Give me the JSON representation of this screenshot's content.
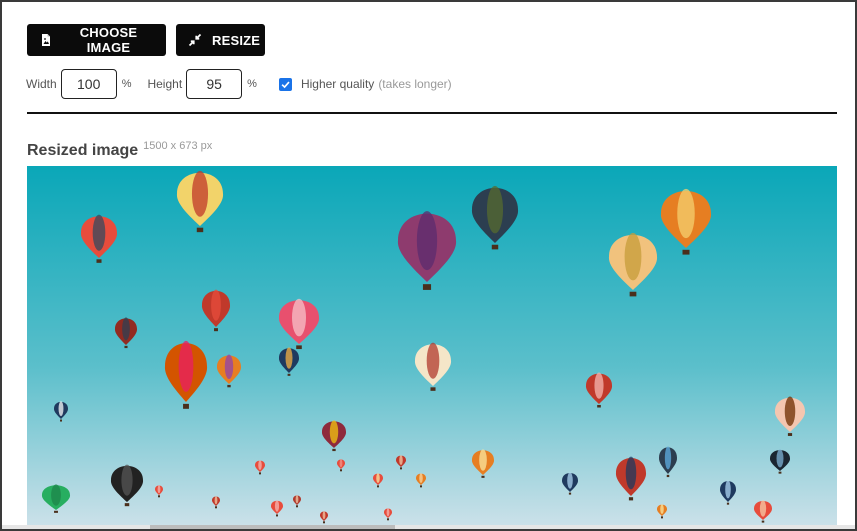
{
  "toolbar": {
    "choose_label": "CHOOSE IMAGE",
    "resize_label": "RESIZE"
  },
  "controls": {
    "width_label": "Width",
    "width_value": "100",
    "width_unit": "%",
    "height_label": "Height",
    "height_value": "95",
    "height_unit": "%",
    "hq_checked": true,
    "hq_label": "Higher quality",
    "hq_hint": "(takes longer)"
  },
  "result": {
    "title": "Resized image",
    "dimensions": "1500 x 673 px"
  },
  "colors": {
    "button_bg": "#0b0b0b",
    "checkbox": "#1a73e8",
    "sky_top": "#0aa7b8",
    "sky_bottom": "#cfe2ea"
  },
  "icons": {
    "choose": "image-file-icon",
    "resize": "shrink-arrows-icon",
    "check": "check-icon"
  }
}
